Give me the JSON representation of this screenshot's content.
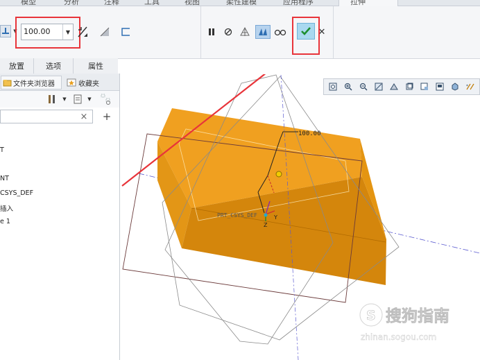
{
  "menu": {
    "items": [
      "模型",
      "分析",
      "注释",
      "工具",
      "视图",
      "柔性建模",
      "应用程序",
      "拉伸"
    ]
  },
  "ribbon": {
    "depth_value": "100.00",
    "depth_arrow": "▼",
    "ok_label": "✓",
    "cancel_label": "✕"
  },
  "option_tabs": {
    "placement": "放置",
    "options": "选项",
    "properties": "属性"
  },
  "browser": {
    "folder_tab": "文件夹浏览器",
    "favorites_tab": "收藏夹",
    "filter_clear": "×",
    "filter_add": "+"
  },
  "tree": {
    "items": [
      "T",
      "NT",
      "CSYS_DEF",
      "插入",
      "e 1"
    ]
  },
  "viewport": {
    "dimension_label": "100.00",
    "csys_label": "PRT_CSYS_DEF",
    "axis_y": "Y",
    "axis_z": "Z"
  },
  "watermark": {
    "brand": "搜狗指南",
    "url": "zhinan.sogou.com",
    "logo_letter": "S"
  },
  "colors": {
    "solid_top": "#f0a020",
    "solid_front": "#d4860c",
    "annotation_red": "#e8343a",
    "datum_plane": "#6b3a3a",
    "ok_green": "#1d8f2f"
  }
}
